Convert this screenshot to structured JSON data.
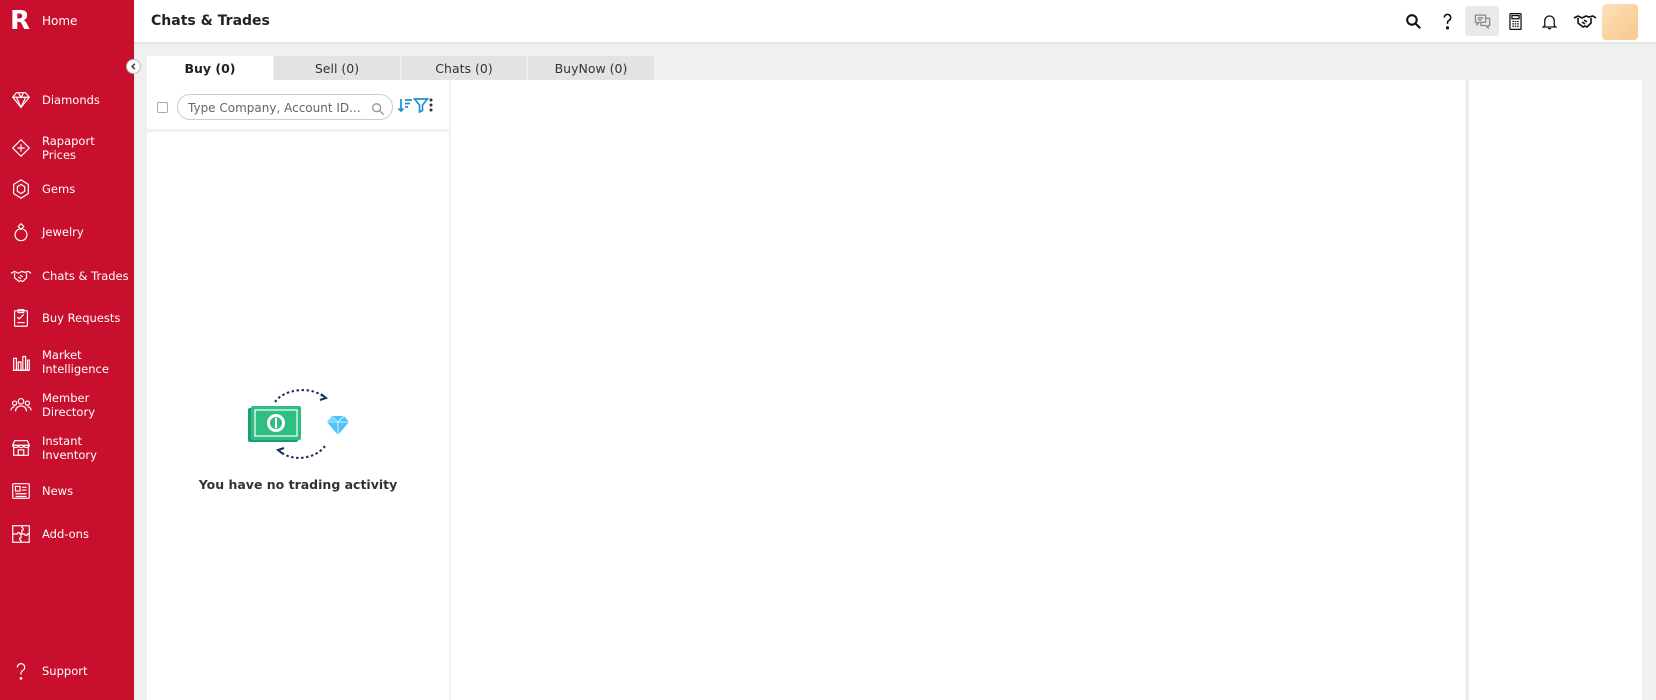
{
  "sidebar": {
    "brand_letter": "R",
    "home_label": "Home",
    "items": [
      {
        "label": "Diamonds",
        "icon": "diamond-icon"
      },
      {
        "label": "Rapaport Prices",
        "icon": "price-tag-icon"
      },
      {
        "label": "Gems",
        "icon": "gem-icon"
      },
      {
        "label": "Jewelry",
        "icon": "ring-icon"
      },
      {
        "label": "Chats & Trades",
        "icon": "handshake-icon"
      },
      {
        "label": "Buy Requests",
        "icon": "clipboard-icon"
      },
      {
        "label": "Market Intelligence",
        "icon": "bar-chart-icon"
      },
      {
        "label": "Member Directory",
        "icon": "people-icon"
      },
      {
        "label": "Instant Inventory",
        "icon": "store-icon"
      },
      {
        "label": "News",
        "icon": "newspaper-icon"
      },
      {
        "label": "Add-ons",
        "icon": "puzzle-icon"
      }
    ],
    "support_label": "Support",
    "accent_color": "#c8102e"
  },
  "header": {
    "title": "Chats & Trades",
    "icons": [
      "search-icon",
      "help-icon",
      "chat-icon",
      "calculator-icon",
      "bell-icon",
      "handshake-icon",
      "avatar"
    ]
  },
  "tabs": [
    {
      "label": "Buy (0)",
      "active": true
    },
    {
      "label": "Sell (0)",
      "active": false
    },
    {
      "label": "Chats (0)",
      "active": false
    },
    {
      "label": "BuyNow (0)",
      "active": false
    }
  ],
  "list": {
    "search_placeholder": "Type Company, Account ID...",
    "empty_message": "You have no trading activity"
  }
}
